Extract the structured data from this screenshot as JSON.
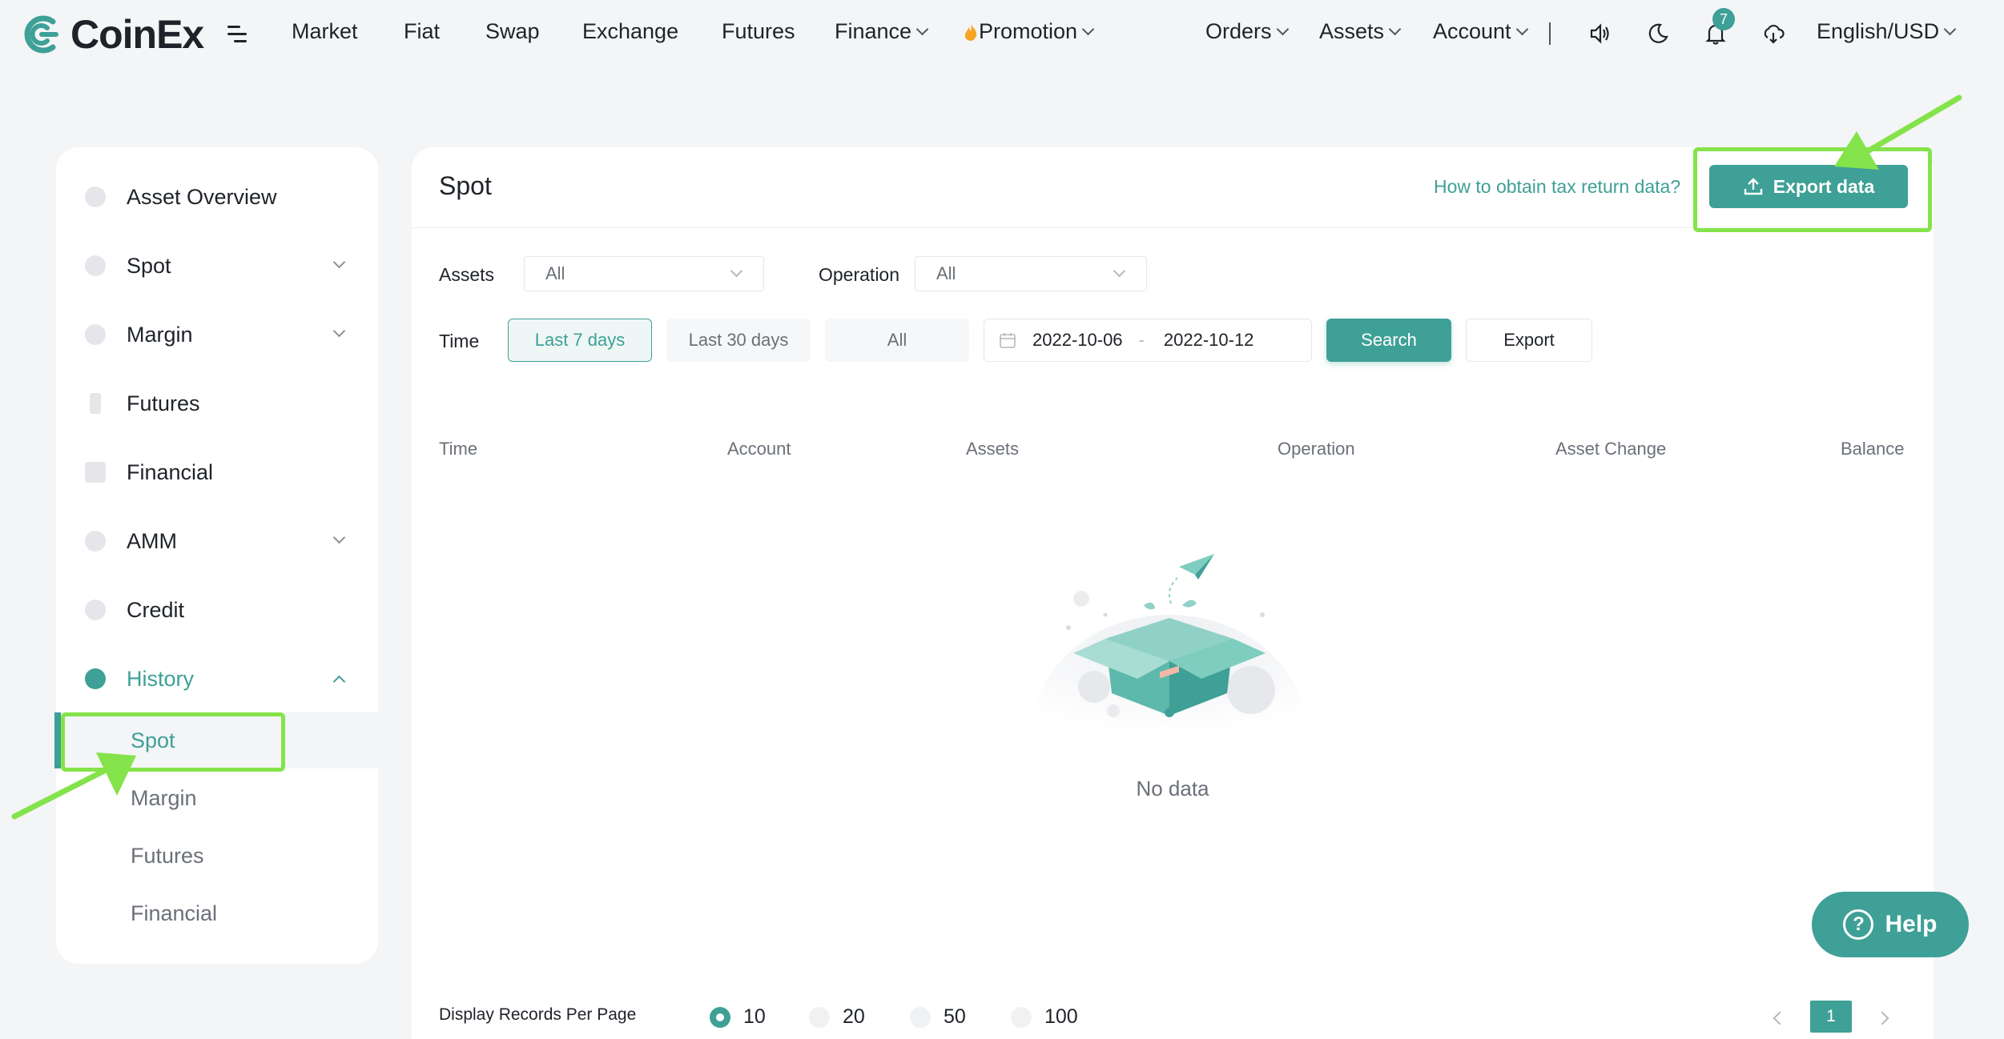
{
  "brand": {
    "name": "CoinEx"
  },
  "topnav": {
    "links": [
      "Market",
      "Fiat",
      "Swap",
      "Exchange",
      "Futures"
    ],
    "finance": "Finance",
    "promotion": "Promotion",
    "orders": "Orders",
    "assets": "Assets",
    "account": "Account",
    "notification_count": "7",
    "language": "English/USD"
  },
  "sidebar": {
    "items": [
      {
        "label": "Asset Overview",
        "expandable": false
      },
      {
        "label": "Spot",
        "expandable": true
      },
      {
        "label": "Margin",
        "expandable": true
      },
      {
        "label": "Futures",
        "expandable": false
      },
      {
        "label": "Financial",
        "expandable": false
      },
      {
        "label": "AMM",
        "expandable": true
      },
      {
        "label": "Credit",
        "expandable": false
      },
      {
        "label": "History",
        "expandable": true,
        "expanded": true
      }
    ],
    "history_sub": [
      "Spot",
      "Margin",
      "Futures",
      "Financial"
    ],
    "selected_sub": "Spot"
  },
  "main": {
    "title": "Spot",
    "tax_link": "How to obtain tax return data?",
    "export_data_label": "Export data",
    "filters": {
      "assets_label": "Assets",
      "assets_value": "All",
      "operation_label": "Operation",
      "operation_value": "All",
      "time_label": "Time",
      "time_options": [
        "Last 7 days",
        "Last 30 days",
        "All"
      ],
      "active_time": "Last 7 days",
      "date_start": "2022-10-06",
      "date_sep": "-",
      "date_end": "2022-10-12",
      "search_label": "Search",
      "export_label": "Export"
    },
    "table": {
      "columns": [
        "Time",
        "Account",
        "Assets",
        "Operation",
        "Asset Change",
        "Balance"
      ],
      "empty_text": "No data"
    },
    "pagination": {
      "per_page_label": "Display Records Per Page",
      "options": [
        "10",
        "20",
        "50",
        "100"
      ],
      "selected": "10",
      "current_page": "1"
    }
  },
  "help": {
    "label": "Help"
  },
  "colors": {
    "accent": "#3ea096",
    "highlight": "#84e34a",
    "background": "#f4f5f7"
  }
}
